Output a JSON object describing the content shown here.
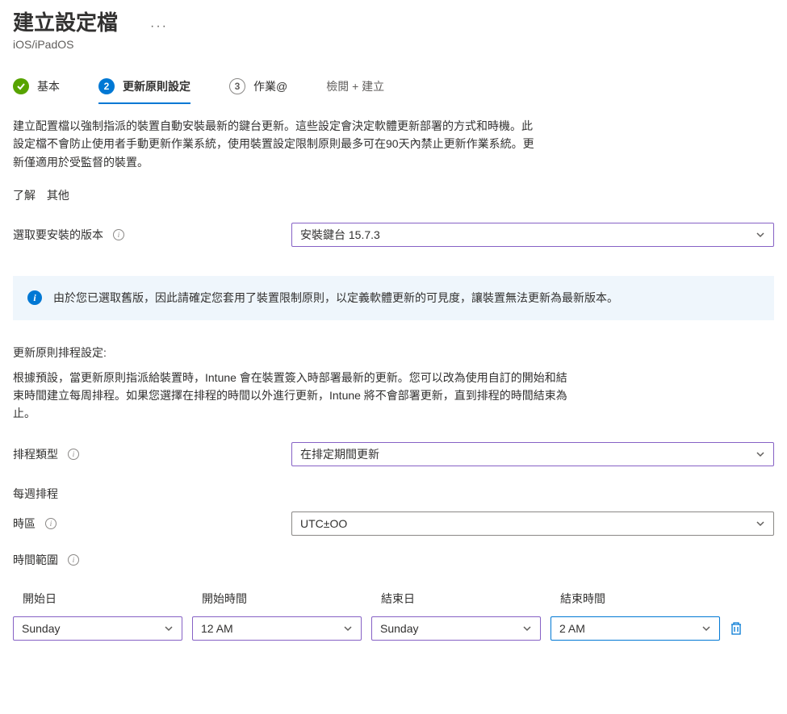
{
  "header": {
    "title": "建立設定檔",
    "subtitle": "iOS/iPadOS",
    "more": "···"
  },
  "steps": {
    "s1_label": "基本",
    "s2_num": "2",
    "s2_label": "更新原則設定",
    "s3_num": "3",
    "s3_label": "作業@",
    "s4_label": "檢閱 + 建立"
  },
  "description": "建立配置檔以強制指派的裝置自動安裝最新的鍵台更新。這些設定會決定軟體更新部署的方式和時機。此設定檔不會防止使用者手動更新作業系統，使用裝置設定限制原則最多可在90天內禁止更新作業系統。更新僅適用於受監督的裝置。",
  "learn": {
    "a": "了解",
    "b": "其他"
  },
  "version": {
    "label": "選取要安裝的版本",
    "value": "安裝鍵台 15.7.3"
  },
  "infobox": "由於您已選取舊版，因此請確定您套用了裝置限制原則，以定義軟體更新的可見度，讓裝置無法更新為最新版本。",
  "schedule": {
    "title": "更新原則排程設定:",
    "desc": "根據預設，當更新原則指派給裝置時，Intune 會在裝置簽入時部署最新的更新。您可以改為使用自訂的開始和結束時間建立每周排程。如果您選擇在排程的時間以外進行更新，Intune 將不會部署更新，直到排程的時間結束為止。",
    "type_label": "排程類型",
    "type_value": "在排定期間更新",
    "weekly_label": "每週排程",
    "tz_label": "時區",
    "tz_value": "UTC±OO",
    "range_label": "時間範圍"
  },
  "timeTable": {
    "h1": "開始日",
    "h2": "開始時間",
    "h3": "結束日",
    "h4": "結束時間",
    "v1": "Sunday",
    "v2": "12 AM",
    "v3": "Sunday",
    "v4": "2 AM"
  }
}
